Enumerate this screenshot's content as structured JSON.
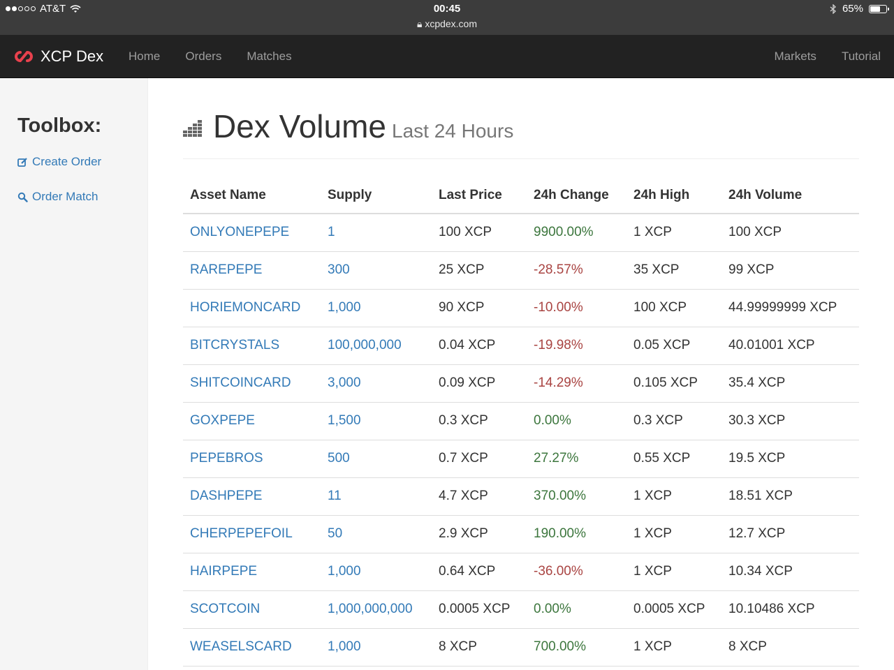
{
  "statusbar": {
    "carrier": "AT&T",
    "time": "00:45",
    "url": "xcpdex.com",
    "battery": "65%",
    "battery_level": 0.65
  },
  "navbar": {
    "brand": "XCP Dex",
    "left_links": [
      "Home",
      "Orders",
      "Matches"
    ],
    "right_links": [
      "Markets",
      "Tutorial"
    ]
  },
  "sidebar": {
    "title": "Toolbox:",
    "links": [
      "Create Order",
      "Order Match"
    ]
  },
  "main": {
    "title": "Dex Volume",
    "subtitle": "Last 24 Hours",
    "columns": [
      "Asset Name",
      "Supply",
      "Last Price",
      "24h Change",
      "24h High",
      "24h Volume"
    ],
    "rows": [
      {
        "asset": "ONLYONEPEPE",
        "supply": "1",
        "last_price": "100 XCP",
        "change": "9900.00%",
        "direction": "up",
        "high": "1 XCP",
        "volume": "100 XCP"
      },
      {
        "asset": "RAREPEPE",
        "supply": "300",
        "last_price": "25 XCP",
        "change": "-28.57%",
        "direction": "down",
        "high": "35 XCP",
        "volume": "99 XCP"
      },
      {
        "asset": "HORIEMONCARD",
        "supply": "1,000",
        "last_price": "90 XCP",
        "change": "-10.00%",
        "direction": "down",
        "high": "100 XCP",
        "volume": "44.99999999 XCP"
      },
      {
        "asset": "BITCRYSTALS",
        "supply": "100,000,000",
        "last_price": "0.04 XCP",
        "change": "-19.98%",
        "direction": "down",
        "high": "0.05 XCP",
        "volume": "40.01001 XCP"
      },
      {
        "asset": "SHITCOINCARD",
        "supply": "3,000",
        "last_price": "0.09 XCP",
        "change": "-14.29%",
        "direction": "down",
        "high": "0.105 XCP",
        "volume": "35.4 XCP"
      },
      {
        "asset": "GOXPEPE",
        "supply": "1,500",
        "last_price": "0.3 XCP",
        "change": "0.00%",
        "direction": "up",
        "high": "0.3 XCP",
        "volume": "30.3 XCP"
      },
      {
        "asset": "PEPEBROS",
        "supply": "500",
        "last_price": "0.7 XCP",
        "change": "27.27%",
        "direction": "up",
        "high": "0.55 XCP",
        "volume": "19.5 XCP"
      },
      {
        "asset": "DASHPEPE",
        "supply": "11",
        "last_price": "4.7 XCP",
        "change": "370.00%",
        "direction": "up",
        "high": "1 XCP",
        "volume": "18.51 XCP"
      },
      {
        "asset": "CHERPEPEFOIL",
        "supply": "50",
        "last_price": "2.9 XCP",
        "change": "190.00%",
        "direction": "up",
        "high": "1 XCP",
        "volume": "12.7 XCP"
      },
      {
        "asset": "HAIRPEPE",
        "supply": "1,000",
        "last_price": "0.64 XCP",
        "change": "-36.00%",
        "direction": "down",
        "high": "1 XCP",
        "volume": "10.34 XCP"
      },
      {
        "asset": "SCOTCOIN",
        "supply": "1,000,000,000",
        "last_price": "0.0005 XCP",
        "change": "0.00%",
        "direction": "up",
        "high": "0.0005 XCP",
        "volume": "10.10486 XCP"
      },
      {
        "asset": "WEASELSCARD",
        "supply": "1,000",
        "last_price": "8 XCP",
        "change": "700.00%",
        "direction": "up",
        "high": "1 XCP",
        "volume": "8 XCP"
      }
    ]
  },
  "colors": {
    "link": "#337ab7",
    "positive": "#3c763d",
    "negative": "#a94442",
    "navbar": "#222222",
    "brand_logo": "#e8414d"
  }
}
